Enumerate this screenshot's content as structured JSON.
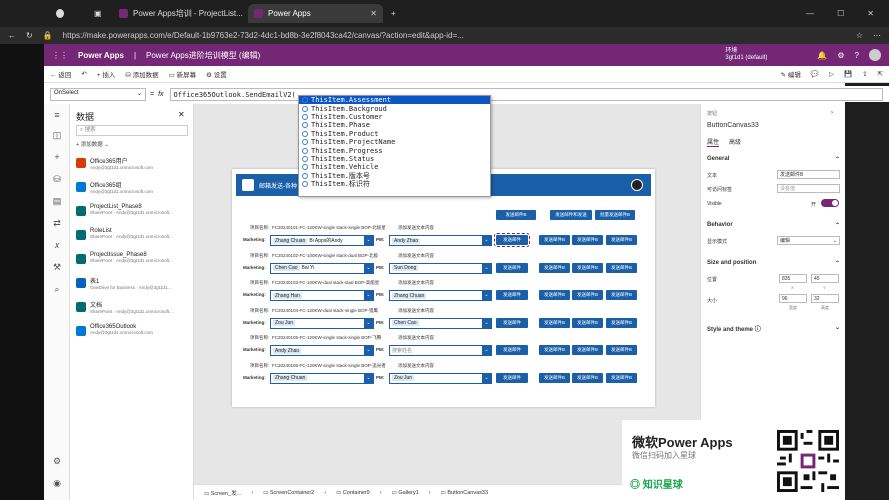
{
  "browser": {
    "tabs": [
      {
        "label": "Power Apps培训 - ProjectList..."
      },
      {
        "label": "Power Apps"
      }
    ],
    "url": "https://make.powerapps.com/e/Default-1b9763e2-73d2-4dc1-bd8b-3e2f8043ca42/canvas/?action=edit&app-id=..."
  },
  "app_header": {
    "product": "Power Apps",
    "app_title": "Power Apps进阶培训模型 (编辑)",
    "env_label": "环境",
    "env_name": "3gt1d1 (default)"
  },
  "command_bar": {
    "back": "返回",
    "insert": "插入",
    "add_data": "添加数据",
    "new_screen": "新屏幕",
    "settings": "设置",
    "edit": "编辑",
    "share": "共享"
  },
  "formula_bar": {
    "property": "OnSelect",
    "fx": "fx",
    "equals": "=",
    "formula": "Office365Outlook.SendEmailV2("
  },
  "intellisense": {
    "items": [
      "ThisItem.Assessment",
      "ThisItem.Backgroud",
      "ThisItem.Customer",
      "ThisItem.Phase",
      "ThisItem.Product",
      "ThisItem.ProjectName",
      "ThisItem.Progress",
      "ThisItem.Status",
      "ThisItem.Vehicle",
      "ThisItem.版本号",
      "ThisItem.标识符"
    ]
  },
  "data_pane": {
    "title": "数据",
    "search_placeholder": "搜索",
    "add_data": "添加数据",
    "sources": [
      {
        "name": "Office365用户",
        "sub": "Andy@3gt1d1.onmicrosoft.com",
        "color": "#d83b01"
      },
      {
        "name": "Office365组",
        "sub": "Andy@3gt1d1.onmicrosoft.com",
        "color": "#0078d4"
      },
      {
        "name": "ProjectList_Phase8",
        "sub": "SharePoint · Andy@3gt1d1.onmicrosoft...",
        "color": "#036c70"
      },
      {
        "name": "RoleList",
        "sub": "SharePoint · Andy@3gt1d1.onmicrosoft...",
        "color": "#036c70"
      },
      {
        "name": "ProjectIssue_Phase8",
        "sub": "SharePoint · Andy@3gt1d1.onmicrosoft...",
        "color": "#036c70"
      },
      {
        "name": "表1",
        "sub": "OneDrive for Business · Andy@3gt1d1...",
        "color": "#0364b8"
      },
      {
        "name": "文档",
        "sub": "SharePoint · Andy@3gt1d1.onmicrosoft...",
        "color": "#036c70"
      },
      {
        "name": "Office365Outlook",
        "sub": "Andy@3gt1d1.onmicrosoft.com",
        "color": "#0078d4"
      }
    ]
  },
  "screen": {
    "header_title": "邮箱发送-各种",
    "top_buttons": [
      "发送邮件B",
      "发送邮件和发送",
      "批量发送邮件B"
    ],
    "project_label": "项目名称:",
    "marketing_label": "Marketing:",
    "pm_label": "PM:",
    "send_content_label": "添加发送文本内容",
    "row_buttons": [
      "发送邮件",
      "发送邮件B",
      "发送邮件B",
      "发送邮件B"
    ],
    "rows": [
      {
        "project": "FC20240101-FC-120KW-single stack-single BOP-北极星",
        "marketing": "Zhang Chuan",
        "marketing2": "Bi Apps的Andy",
        "pm": "Andy Zhao"
      },
      {
        "project": "FC20240102-FC-100KW-single stack-dual BOP-北极",
        "marketing": "Chen Cao",
        "marketing2": "Bai Yi",
        "pm": "Sun Dong"
      },
      {
        "project": "FC20240103-FC-100KW-dual stack-dual BOP-高能星",
        "marketing": "Zhang Han",
        "marketing2": "",
        "pm": "Zhang Chuan"
      },
      {
        "project": "FC20240104-FC-120KW-dual stack-single BOP-猎鹰",
        "marketing": "Zou Jun",
        "marketing2": "",
        "pm": "Chen Cao"
      },
      {
        "project": "FC20240105-FC-120KW-single stack-single BOP-飞腾",
        "marketing": "Andy Zhao",
        "marketing2": "",
        "pm": "搜索姓名"
      },
      {
        "project": "FC20240106-FC-120KW-single stack-single BOP-追光者",
        "marketing": "Zhang Chuan",
        "marketing2": "",
        "pm": "Zou Jun"
      }
    ]
  },
  "right_pane": {
    "small_label": "按钮",
    "control_name": "ButtonCanvas33",
    "tab_props": "属性",
    "tab_advanced": "高级",
    "general": "General",
    "text_label": "文本",
    "text_value": "发送邮件B",
    "accessible_label": "可访问标签",
    "accessible_value": "没有值",
    "visible_label": "Visible",
    "visible_state": "开",
    "behavior": "Behavior",
    "display_mode_label": "显示模式",
    "display_mode_value": "编辑",
    "size_position": "Size and position",
    "position_label": "位置",
    "x": "835",
    "y": "45",
    "x_label": "X",
    "y_label": "Y",
    "size_label": "大小",
    "w": "96",
    "h": "32",
    "w_label": "宽度",
    "h_label": "高度",
    "style_theme": "Style and theme"
  },
  "bottom_bar": {
    "items": [
      "Screen_发...",
      "ScreenContainer2",
      "Container9",
      "Gallery1",
      "ButtonCanvas33"
    ]
  },
  "watermark": {
    "title": "微软Power Apps",
    "subtitle": "微信扫码加入星球",
    "brand": "知识星球"
  }
}
